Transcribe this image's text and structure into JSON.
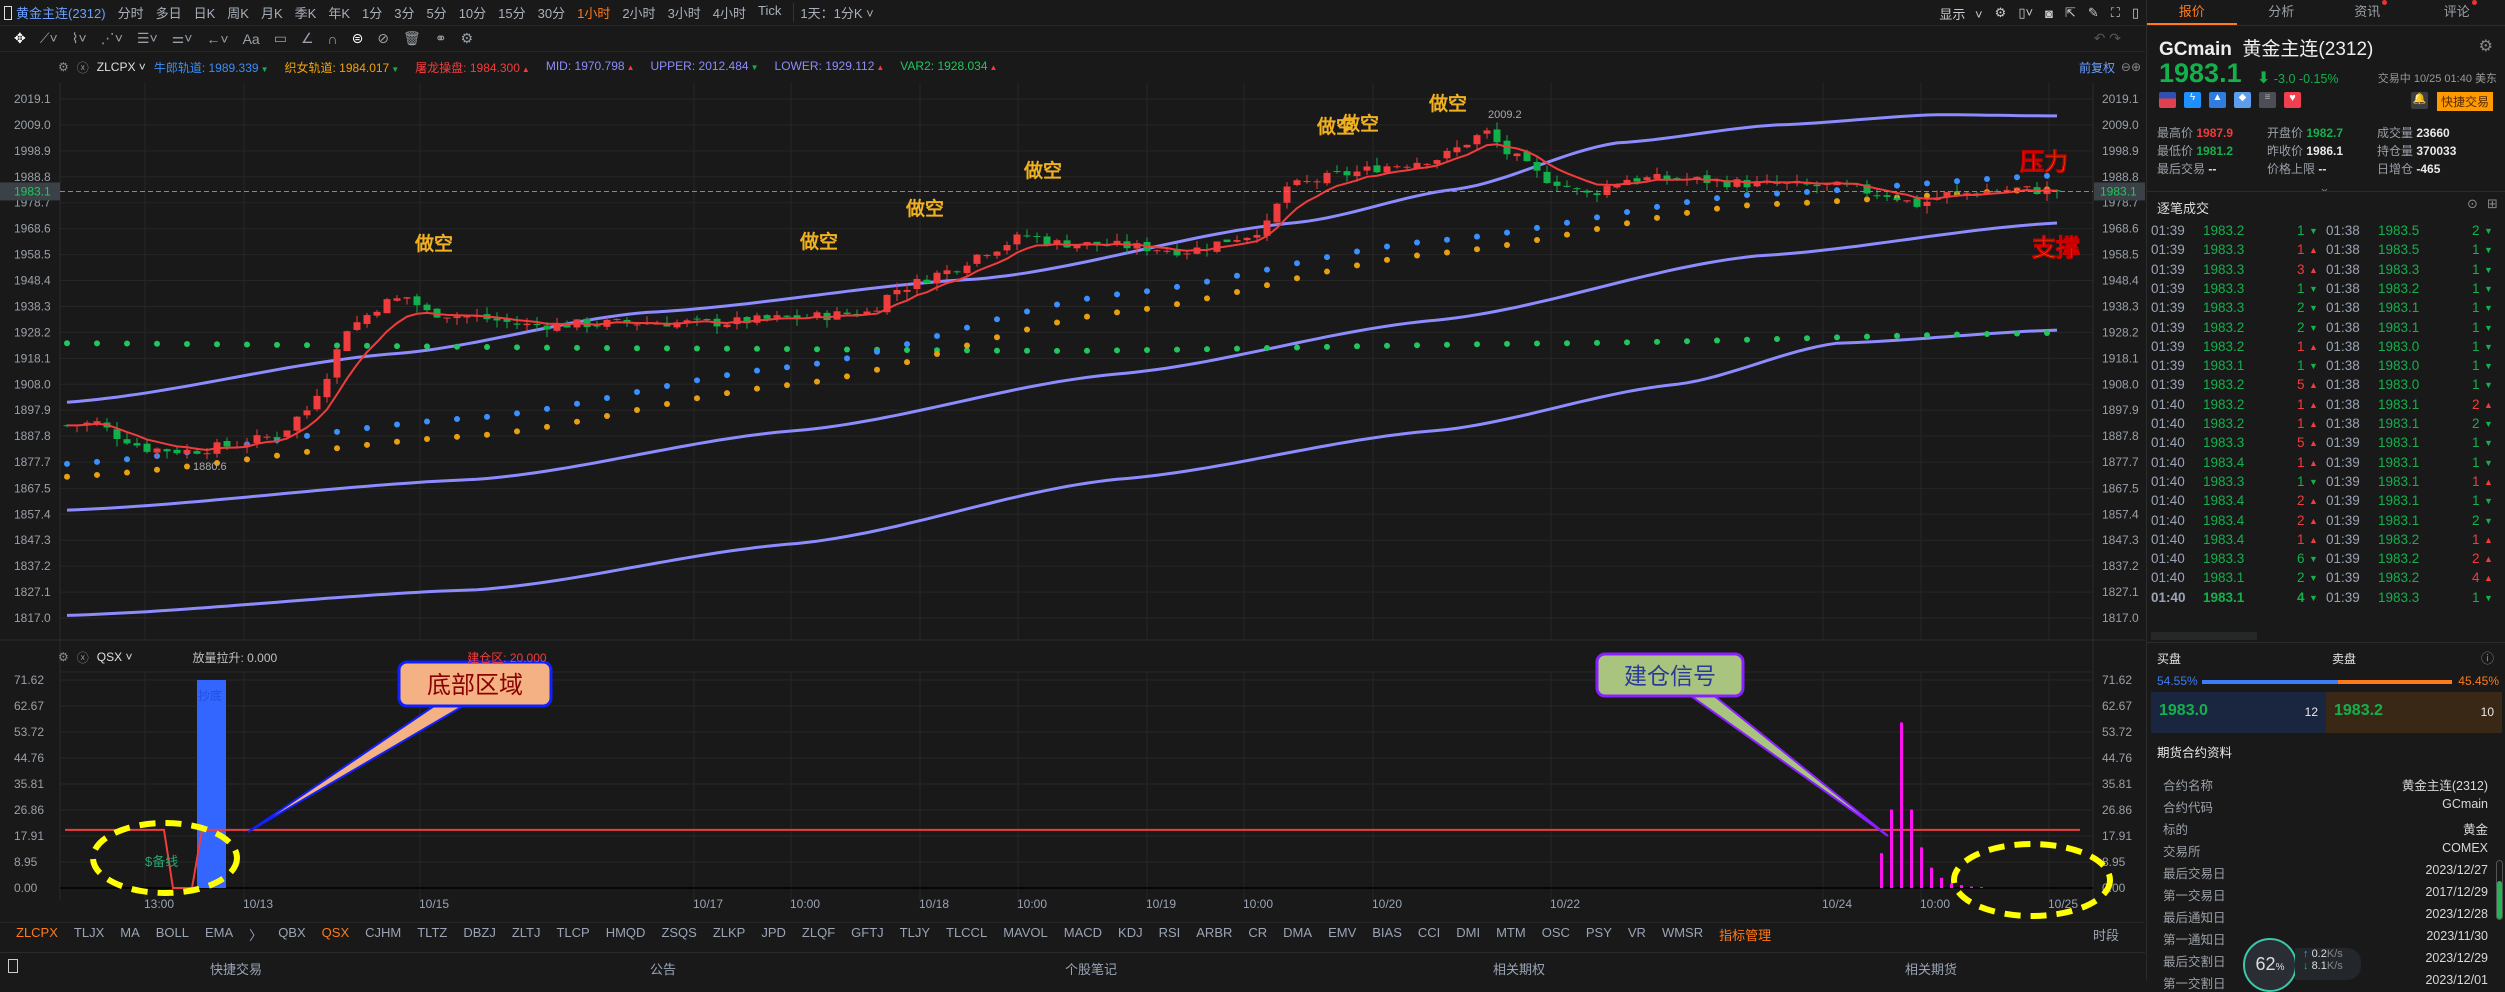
{
  "toolbar": {
    "symbol": "黄金主连(2312)",
    "periods": [
      "分时",
      "多日",
      "日K",
      "周K",
      "月K",
      "季K",
      "年K",
      "1分",
      "3分",
      "5分",
      "10分",
      "15分",
      "30分",
      "1小时",
      "2小时",
      "3小时",
      "4小时",
      "Tick"
    ],
    "active_period": "1小时",
    "custom_period": "1天：1分K",
    "display_label": "显示"
  },
  "legend": {
    "indicator": "ZLCPX",
    "items": [
      {
        "name": "牛郎轨道:",
        "value": "1989.339",
        "dir": "▼",
        "color": "#3d8ef7",
        "dcolor": "#14b04c"
      },
      {
        "name": "织女轨道:",
        "value": "1984.017",
        "dir": "▼",
        "color": "#f0a30a",
        "dcolor": "#14b04c"
      },
      {
        "name": "屠龙操盘:",
        "value": "1984.300",
        "dir": "▲",
        "color": "#f23c3c",
        "dcolor": "#f23c3c"
      },
      {
        "name": "MID:",
        "value": "1970.798",
        "dir": "▲",
        "color": "#8c8cff",
        "dcolor": "#f23c3c"
      },
      {
        "name": "UPPER:",
        "value": "2012.484",
        "dir": "▼",
        "color": "#8c8cff",
        "dcolor": "#14b04c"
      },
      {
        "name": "LOWER:",
        "value": "1929.112",
        "dir": "▲",
        "color": "#8c8cff",
        "dcolor": "#f23c3c"
      },
      {
        "name": "VAR2:",
        "value": "1928.034",
        "dir": "▲",
        "color": "#22c55e",
        "dcolor": "#f23c3c"
      }
    ],
    "adjust": "前复权"
  },
  "sub_legend": {
    "indicator": "QSX",
    "items": [
      {
        "name": "放量拉升:",
        "value": "0.000",
        "color": "#c0c0c0"
      },
      {
        "name": "建仓区:",
        "value": "20.000",
        "color": "#f23c3c"
      }
    ]
  },
  "chart_data": {
    "type": "candlestick",
    "y_ticks": [
      "2019.1",
      "2009.0",
      "1998.9",
      "1988.8",
      "1978.7",
      "1968.6",
      "1958.5",
      "1948.4",
      "1938.3",
      "1928.2",
      "1918.1",
      "1908.0",
      "1897.9",
      "1887.8",
      "1877.7",
      "1867.5",
      "1857.4",
      "1847.3",
      "1837.2",
      "1827.1",
      "1817.0"
    ],
    "ylim": [
      1817.0,
      2019.1
    ],
    "x_labels": [
      "13:00",
      "10/13",
      "10/15",
      "10/17",
      "10:00",
      "10/18",
      "10:00",
      "10/19",
      "10:00",
      "10/20",
      "10/22",
      "10/24",
      "10:00",
      "10/25"
    ],
    "candles": 200,
    "close_path": [
      [
        0,
        1892
      ],
      [
        3,
        1893
      ],
      [
        5,
        1888
      ],
      [
        8,
        1883
      ],
      [
        12,
        1882
      ],
      [
        16,
        1884
      ],
      [
        21,
        1888
      ],
      [
        24,
        1898
      ],
      [
        26,
        1912
      ],
      [
        28,
        1930
      ],
      [
        32,
        1940
      ],
      [
        34,
        1942
      ],
      [
        36,
        1936
      ],
      [
        41,
        1934
      ],
      [
        46,
        1931
      ],
      [
        57,
        1932
      ],
      [
        65,
        1932
      ],
      [
        73,
        1934
      ],
      [
        80,
        1936
      ],
      [
        83,
        1945
      ],
      [
        88,
        1952
      ],
      [
        92,
        1960
      ],
      [
        96,
        1966
      ],
      [
        99,
        1963
      ],
      [
        105,
        1962
      ],
      [
        112,
        1960
      ],
      [
        118,
        1966
      ],
      [
        120,
        1970
      ],
      [
        122,
        1985
      ],
      [
        128,
        1990
      ],
      [
        132,
        1993
      ],
      [
        137,
        1996
      ],
      [
        142,
        2006
      ],
      [
        144,
        1998
      ],
      [
        148,
        1988
      ],
      [
        152,
        1982
      ],
      [
        156,
        1988
      ],
      [
        161,
        1988
      ],
      [
        169,
        1986
      ],
      [
        177,
        1985
      ],
      [
        182,
        1982
      ],
      [
        185,
        1978
      ],
      [
        188,
        1982
      ],
      [
        195,
        1984
      ],
      [
        199,
        1983.1
      ]
    ],
    "upper": [
      [
        0,
        1901
      ],
      [
        33,
        1920
      ],
      [
        58,
        1936
      ],
      [
        91,
        1949
      ],
      [
        123,
        1971
      ],
      [
        139,
        1984
      ],
      [
        155,
        2002
      ],
      [
        171,
        2009
      ],
      [
        187,
        2013
      ],
      [
        199,
        2012.5
      ]
    ],
    "mid": [
      [
        0,
        1859
      ],
      [
        41,
        1871
      ],
      [
        73,
        1890
      ],
      [
        105,
        1912
      ],
      [
        137,
        1933
      ],
      [
        169,
        1958
      ],
      [
        199,
        1970.8
      ]
    ],
    "lower": [
      [
        0,
        1818
      ],
      [
        41,
        1828
      ],
      [
        73,
        1846
      ],
      [
        105,
        1871
      ],
      [
        137,
        1890
      ],
      [
        161,
        1908
      ],
      [
        177,
        1924
      ],
      [
        199,
        1929.1
      ]
    ],
    "var2": [
      [
        0,
        1924
      ],
      [
        60,
        1922
      ],
      [
        100,
        1921
      ],
      [
        150,
        1924
      ],
      [
        199,
        1928
      ]
    ],
    "niulang": [
      [
        0,
        1877
      ],
      [
        41,
        1895
      ],
      [
        73,
        1915
      ],
      [
        105,
        1943
      ],
      [
        137,
        1964
      ],
      [
        169,
        1982
      ],
      [
        199,
        1989.3
      ]
    ],
    "zhinv": [
      [
        0,
        1872
      ],
      [
        41,
        1888
      ],
      [
        73,
        1908
      ],
      [
        105,
        1936
      ],
      [
        137,
        1959
      ],
      [
        169,
        1978
      ],
      [
        199,
        1984
      ]
    ],
    "current_price": "1983.1",
    "high_label": "2009.2",
    "low_label": "1880.6",
    "sell_signals": [
      "做空",
      "做空",
      "做空",
      "做空",
      "做空",
      "做空",
      "做空"
    ],
    "sub": {
      "y_ticks": [
        "71.62",
        "62.67",
        "53.72",
        "44.76",
        "35.81",
        "26.86",
        "17.91",
        "8.95",
        "0.00"
      ],
      "ylim": [
        0,
        71.62
      ],
      "zone_level": 20,
      "bottom_bar": 71.62,
      "bottom_bar_label": "抄底",
      "reserve_label": "$备线",
      "build_bars": [
        12,
        27,
        57,
        27,
        14,
        7,
        3.5,
        1.5,
        1,
        0.5,
        0.3
      ]
    }
  },
  "annotations": {
    "resistance": "压力",
    "support": "支撑",
    "bottom_zone": "底部区域",
    "build_signal": "建仓信号"
  },
  "indicator_tabs": [
    "ZLCPX",
    "TLJX",
    "MA",
    "BOLL",
    "EMA",
    "QBX",
    "QSX",
    "CJHM",
    "TLTZ",
    "DBZJ",
    "ZLTJ",
    "TLCP",
    "HMQD",
    "ZSQS",
    "ZLKP",
    "JPD",
    "ZLQF",
    "GFTJ",
    "TLJY",
    "TLCCL",
    "MAVOL",
    "MACD",
    "KDJ",
    "RSI",
    "ARBR",
    "CR",
    "DMA",
    "EMV",
    "BIAS",
    "CCI",
    "DMI",
    "MTM",
    "OSC",
    "PSY",
    "VR",
    "WMSR"
  ],
  "indicator_manage": "指标管理",
  "period_label": "时段",
  "bottom_bar": [
    "快捷交易",
    "公告",
    "个股笔记",
    "相关期权",
    "相关期货"
  ],
  "right": {
    "tabs": [
      "报价",
      "分析",
      "资讯",
      "评论"
    ],
    "code": "GCmain",
    "name": "黄金主连(2312)",
    "price": "1983.1",
    "change": "-3.0",
    "pct": "-0.15%",
    "status": "交易中 10/25 01:40 美东",
    "quick_trade": "快捷交易",
    "stats": [
      [
        "最高价",
        "1987.9",
        "r"
      ],
      [
        "开盘价",
        "1982.7",
        "g"
      ],
      [
        "成交量",
        "23660",
        "w"
      ],
      [
        "最低价",
        "1981.2",
        "g"
      ],
      [
        "昨收价",
        "1986.1",
        "w"
      ],
      [
        "持仓量",
        "370033",
        "w"
      ],
      [
        "最后交易",
        "--",
        "w"
      ],
      [
        "价格上限",
        "--",
        "w"
      ],
      [
        "日增仓",
        "-465",
        "w"
      ]
    ],
    "trades_title": "逐笔成交",
    "trades_left": [
      [
        "01:39",
        "1983.2",
        "1",
        "d"
      ],
      [
        "01:39",
        "1983.3",
        "1",
        "u"
      ],
      [
        "01:39",
        "1983.3",
        "3",
        "u"
      ],
      [
        "01:39",
        "1983.3",
        "1",
        "d"
      ],
      [
        "01:39",
        "1983.3",
        "2",
        "d"
      ],
      [
        "01:39",
        "1983.2",
        "2",
        "d"
      ],
      [
        "01:39",
        "1983.2",
        "1",
        "u"
      ],
      [
        "01:39",
        "1983.1",
        "1",
        "d"
      ],
      [
        "01:39",
        "1983.2",
        "5",
        "u"
      ],
      [
        "01:40",
        "1983.2",
        "1",
        "u"
      ],
      [
        "01:40",
        "1983.2",
        "1",
        "u"
      ],
      [
        "01:40",
        "1983.3",
        "5",
        "u"
      ],
      [
        "01:40",
        "1983.4",
        "1",
        "u"
      ],
      [
        "01:40",
        "1983.3",
        "1",
        "d"
      ],
      [
        "01:40",
        "1983.4",
        "2",
        "u"
      ],
      [
        "01:40",
        "1983.4",
        "2",
        "u"
      ],
      [
        "01:40",
        "1983.4",
        "1",
        "u"
      ],
      [
        "01:40",
        "1983.3",
        "6",
        "d"
      ],
      [
        "01:40",
        "1983.1",
        "2",
        "d"
      ],
      [
        "01:40",
        "1983.1",
        "4",
        "d"
      ]
    ],
    "trades_right": [
      [
        "01:38",
        "1983.5",
        "2",
        "d"
      ],
      [
        "01:38",
        "1983.5",
        "1",
        "d"
      ],
      [
        "01:38",
        "1983.3",
        "1",
        "d"
      ],
      [
        "01:38",
        "1983.2",
        "1",
        "d"
      ],
      [
        "01:38",
        "1983.1",
        "1",
        "d"
      ],
      [
        "01:38",
        "1983.1",
        "1",
        "d"
      ],
      [
        "01:38",
        "1983.0",
        "1",
        "d"
      ],
      [
        "01:38",
        "1983.0",
        "1",
        "d"
      ],
      [
        "01:38",
        "1983.0",
        "1",
        "d"
      ],
      [
        "01:38",
        "1983.1",
        "2",
        "u"
      ],
      [
        "01:38",
        "1983.1",
        "2",
        "d"
      ],
      [
        "01:39",
        "1983.1",
        "1",
        "d"
      ],
      [
        "01:39",
        "1983.1",
        "1",
        "d"
      ],
      [
        "01:39",
        "1983.1",
        "1",
        "u"
      ],
      [
        "01:39",
        "1983.1",
        "1",
        "d"
      ],
      [
        "01:39",
        "1983.1",
        "2",
        "d"
      ],
      [
        "01:39",
        "1983.2",
        "1",
        "u"
      ],
      [
        "01:39",
        "1983.2",
        "2",
        "u"
      ],
      [
        "01:39",
        "1983.2",
        "4",
        "u"
      ],
      [
        "01:39",
        "1983.3",
        "1",
        "d"
      ]
    ],
    "bid_label": "买盘",
    "ask_label": "卖盘",
    "bid_pct": "54.55%",
    "ask_pct": "45.45%",
    "bid_ratio": 0.5455,
    "bid": "1983.0",
    "bid_vol": "12",
    "ask": "1983.2",
    "ask_vol": "10",
    "contract_title": "期货合约资料",
    "contract": [
      [
        "合约名称",
        "黄金主连(2312)"
      ],
      [
        "合约代码",
        "GCmain"
      ],
      [
        "标的",
        "黄金"
      ],
      [
        "交易所",
        "COMEX"
      ],
      [
        "最后交易日",
        "2023/12/27"
      ],
      [
        "第一交易日",
        "2017/12/29"
      ],
      [
        "最后通知日",
        "2023/12/28"
      ],
      [
        "第一通知日",
        "2023/11/30"
      ],
      [
        "最后交割日",
        "2023/12/29"
      ],
      [
        "第一交割日",
        "2023/12/01"
      ]
    ],
    "net": {
      "pct": "62",
      "up": "0.2",
      "down": "8.1",
      "unit": "K/s"
    }
  }
}
